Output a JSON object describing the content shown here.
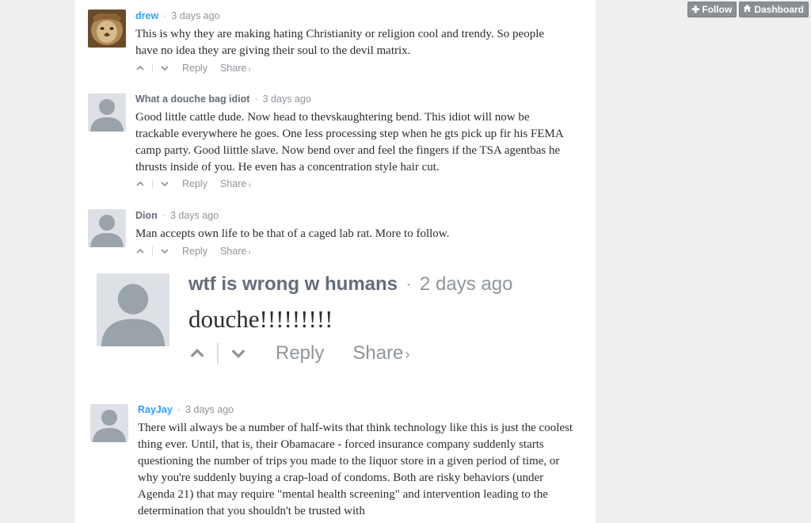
{
  "header": {
    "follow_label": "Follow",
    "follow_icon": "plus-icon",
    "dashboard_label": "Dashboard",
    "dashboard_icon": "home-icon"
  },
  "actions": {
    "reply": "Reply",
    "share": "Share"
  },
  "comments": [
    {
      "author": "drew",
      "time": "3 days ago",
      "body": "This is why they are making hating Christianity or religion cool and trendy. So people have no idea they are giving their soul to the devil matrix.",
      "avatar": "lion-photo"
    },
    {
      "author": "What a douche bag idiot",
      "time": "3 days ago",
      "body": "Good little cattle dude. Now head to thevskaughtering bend. This idiot will now be trackable everywhere he goes. One less processing step when he gts pick up fir his FEMA camp party. Good liittle slave. Now bend over and feel the fingers if the TSA agentbas he thrusts inside of you. He even has a concentration style hair cut.",
      "avatar": "default"
    },
    {
      "author": "Dion",
      "time": "3 days ago",
      "body": "Man accepts own life to be that of a caged lab rat. More to follow.",
      "avatar": "default"
    },
    {
      "author": "wtf is wrong w humans",
      "time": "2 days ago",
      "body": "douche!!!!!!!!!",
      "avatar": "default"
    },
    {
      "author": "RayJay",
      "time": "3 days ago",
      "body": "There will always be a number of half-wits that think technology like this is just the coolest thing ever. Until, that is, their Obamacare - forced insurance company suddenly starts questioning the number of trips you made to the liquor store in a given period of time, or why you're suddenly buying a crap-load of condoms. Both are risky behaviors (under Agenda 21) that may require \"mental health screening\" and intervention leading to the determination that you shouldn't be trusted with",
      "avatar": "default"
    }
  ],
  "colors": {
    "link": "#2e9fff",
    "meta": "#8f959b",
    "avatar_bg": "#dde1e5"
  }
}
